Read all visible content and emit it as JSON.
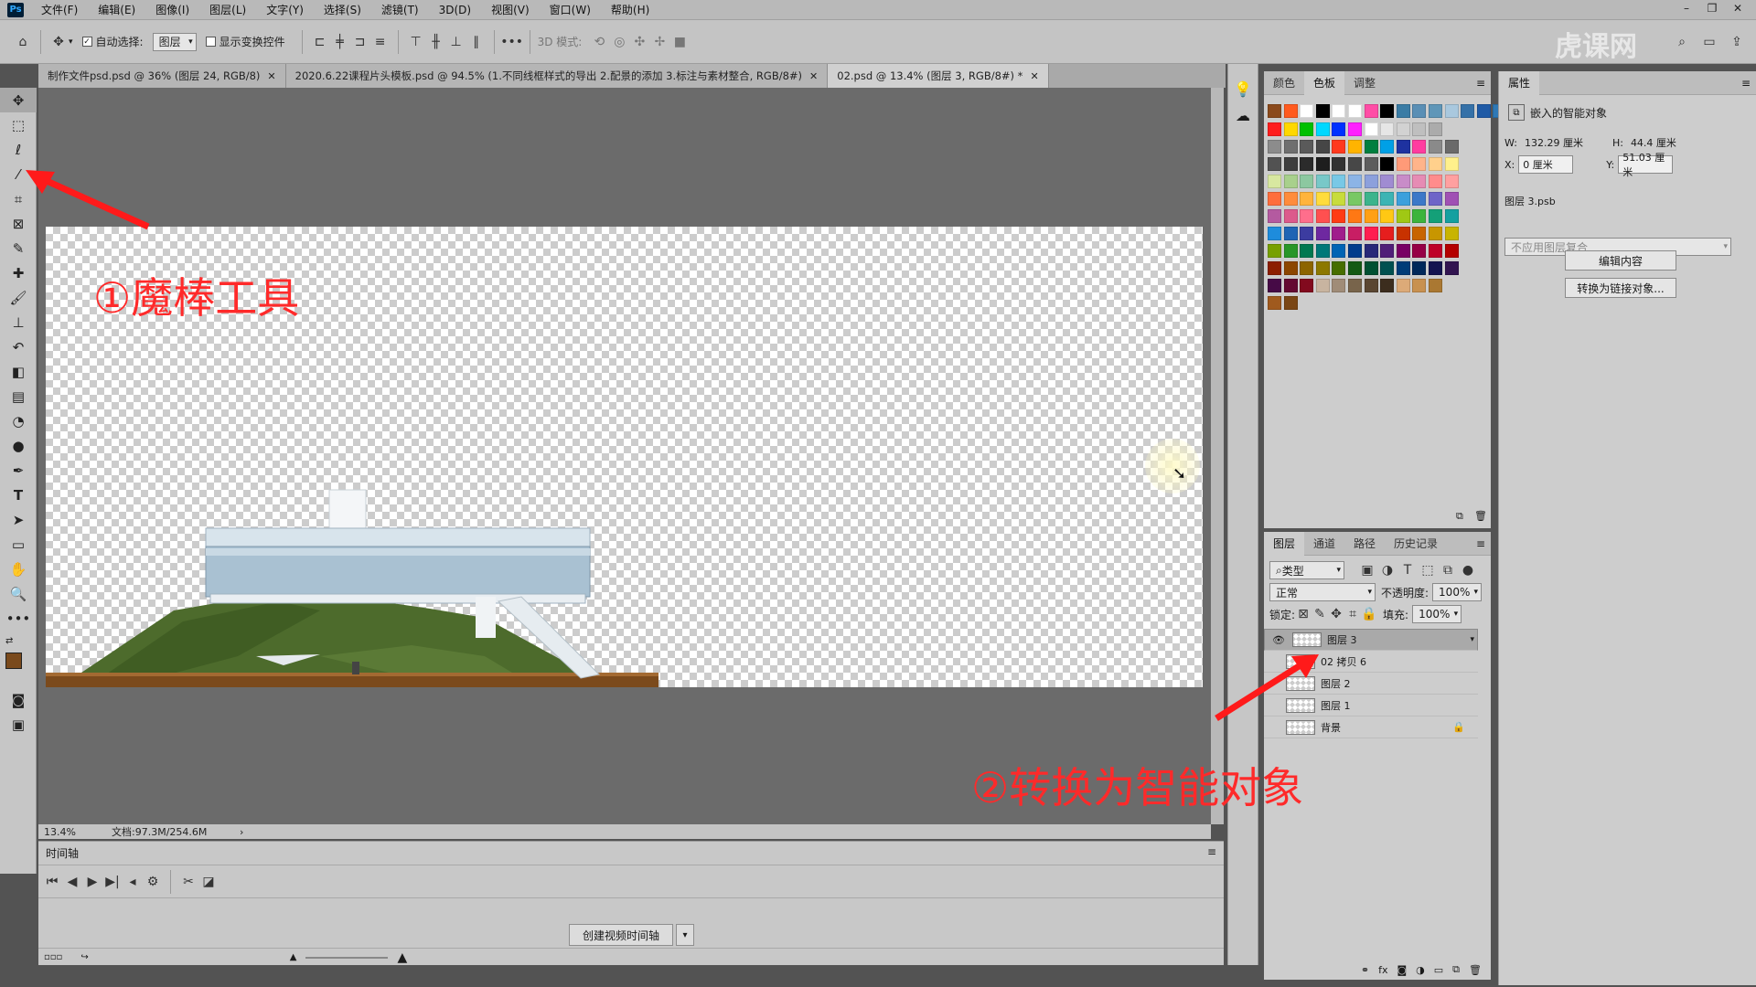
{
  "menubar": {
    "items": [
      "文件(F)",
      "编辑(E)",
      "图像(I)",
      "图层(L)",
      "文字(Y)",
      "选择(S)",
      "滤镜(T)",
      "3D(D)",
      "视图(V)",
      "窗口(W)",
      "帮助(H)"
    ]
  },
  "options": {
    "auto_select_label": "自动选择:",
    "auto_select_value": "图层",
    "show_transform_label": "显示变换控件",
    "mode_3d_label": "3D 模式:"
  },
  "tabs": [
    {
      "label": "制作文件psd.psd @ 36% (图层 24, RGB/8)"
    },
    {
      "label": "2020.6.22课程片头模板.psd @ 94.5% (1.不同线框样式的导出 2.配景的添加 3.标注与素材整合, RGB/8#)"
    },
    {
      "label": "02.psd @ 13.4% (图层 3, RGB/8#) *"
    }
  ],
  "status": {
    "zoom": "13.4%",
    "doc": "文档:97.3M/254.6M"
  },
  "timeline": {
    "title": "时间轴",
    "create_label": "创建视频时间轴"
  },
  "swatches": {
    "tabs": [
      "颜色",
      "色板",
      "调整"
    ],
    "colors": [
      [
        "#8b4a1c",
        "#ff5a1e",
        "#ffffff",
        "#000000",
        "#ffffff",
        "#ffffff",
        "#ff4da6",
        "#000000",
        "#3a7ca5",
        "#5a8fb5",
        "#5f96b8",
        "#a9c8de",
        "#3571a8",
        "#1f5aa6",
        "#2e78b5"
      ],
      [
        "#ff1e1e",
        "#ffd800",
        "#00c000",
        "#00d8ff",
        "#0030ff",
        "#ff20ff",
        "#ffffff",
        "#e6e6e6",
        "#d2d2d2",
        "#bfbfbf",
        "#ababab"
      ],
      [
        "#8c8c8c",
        "#6f6f6f",
        "#5a5a5a",
        "#464646",
        "#ff3a1e",
        "#ffb400",
        "#007f3f",
        "#00a0e6",
        "#1e32a0",
        "#ff3ca0",
        "#8a8a8a",
        "#6a6a6a"
      ],
      [
        "#525252",
        "#3e3e3e",
        "#2b2b2b",
        "#1e1e1e",
        "#323232",
        "#474747",
        "#5d5d5d",
        "#000000",
        "#ff9a78",
        "#ffb48a",
        "#ffd08c",
        "#fff08c"
      ],
      [
        "#d8e8a0",
        "#a8d08c",
        "#8cc8a0",
        "#78c8c8",
        "#78c8e6",
        "#8cb4e6",
        "#8ca0dc",
        "#a08cd2",
        "#c88cc8",
        "#e68cb4",
        "#ff8c8c",
        "#ffa0a0"
      ],
      [
        "#ff6e3c",
        "#ff8c3c",
        "#ffb43c",
        "#ffdc3c",
        "#c8dc3c",
        "#78c864",
        "#3cb48c",
        "#3cb4b4",
        "#3ca0dc",
        "#3c78c8",
        "#6e64c8",
        "#a050b4"
      ],
      [
        "#b45aa0",
        "#dc5a8c",
        "#ff6e8c",
        "#ff5050",
        "#ff3c14",
        "#ff7814",
        "#ffa014",
        "#ffc814",
        "#a0c814",
        "#3cb43c",
        "#14a078",
        "#14a0a0"
      ],
      [
        "#1e8cdc",
        "#1e64b4",
        "#3c3ca0",
        "#6e28a0",
        "#a01e8c",
        "#c81e64",
        "#ff1e50",
        "#e61e1e",
        "#c83200",
        "#c86400",
        "#c89600",
        "#c8b400"
      ],
      [
        "#78a000",
        "#289628",
        "#007850",
        "#007878",
        "#0064b4",
        "#003c8c",
        "#282878",
        "#501e78",
        "#780064",
        "#960046",
        "#be0028",
        "#b40000"
      ],
      [
        "#8c1e00",
        "#8c4600",
        "#8c6400",
        "#8c7800",
        "#466e00",
        "#145a14",
        "#005032",
        "#005050",
        "#003c78",
        "#00285a",
        "#141450",
        "#321450"
      ],
      [
        "#460a46",
        "#640a32",
        "#820a1e",
        "#c8b4a0",
        "#a08c78",
        "#78644b",
        "#5a4632",
        "#3c2d1e",
        "#dcaa78",
        "#c89150",
        "#aa7832"
      ],
      [
        "#a05a1e",
        "#7a4614"
      ]
    ]
  },
  "layers": {
    "tabs": [
      "图层",
      "通道",
      "路径",
      "历史记录"
    ],
    "filter_label": "类型",
    "blend_mode": "正常",
    "opacity_label": "不透明度:",
    "opacity_value": "100%",
    "lock_label": "锁定:",
    "fill_label": "填充:",
    "fill_value": "100%",
    "items": [
      {
        "name": "图层 3",
        "visible": true,
        "selected": true,
        "smart": true,
        "locked": false
      },
      {
        "name": "02 拷贝 6",
        "visible": false,
        "selected": false,
        "smart": false,
        "locked": false
      },
      {
        "name": "图层 2",
        "visible": false,
        "selected": false,
        "smart": false,
        "locked": false
      },
      {
        "name": "图层 1",
        "visible": false,
        "selected": false,
        "smart": false,
        "locked": false
      },
      {
        "name": "背景",
        "visible": false,
        "selected": false,
        "smart": false,
        "locked": true
      }
    ]
  },
  "properties": {
    "tab": "属性",
    "type_label": "嵌入的智能对象",
    "w_label": "W:",
    "w_value": "132.29 厘米",
    "h_label": "H:",
    "h_value": "44.4 厘米",
    "x_label": "X:",
    "x_value": "0 厘米",
    "y_label": "Y:",
    "y_value": "51.03 厘米",
    "file_label": "图层 3.psb",
    "comp_placeholder": "不应用图层复合",
    "edit_btn": "编辑内容",
    "convert_btn": "转换为链接对象..."
  },
  "annotations": {
    "one": "①魔棒工具",
    "two": "②转换为智能对象"
  },
  "watermark": "虎课网"
}
